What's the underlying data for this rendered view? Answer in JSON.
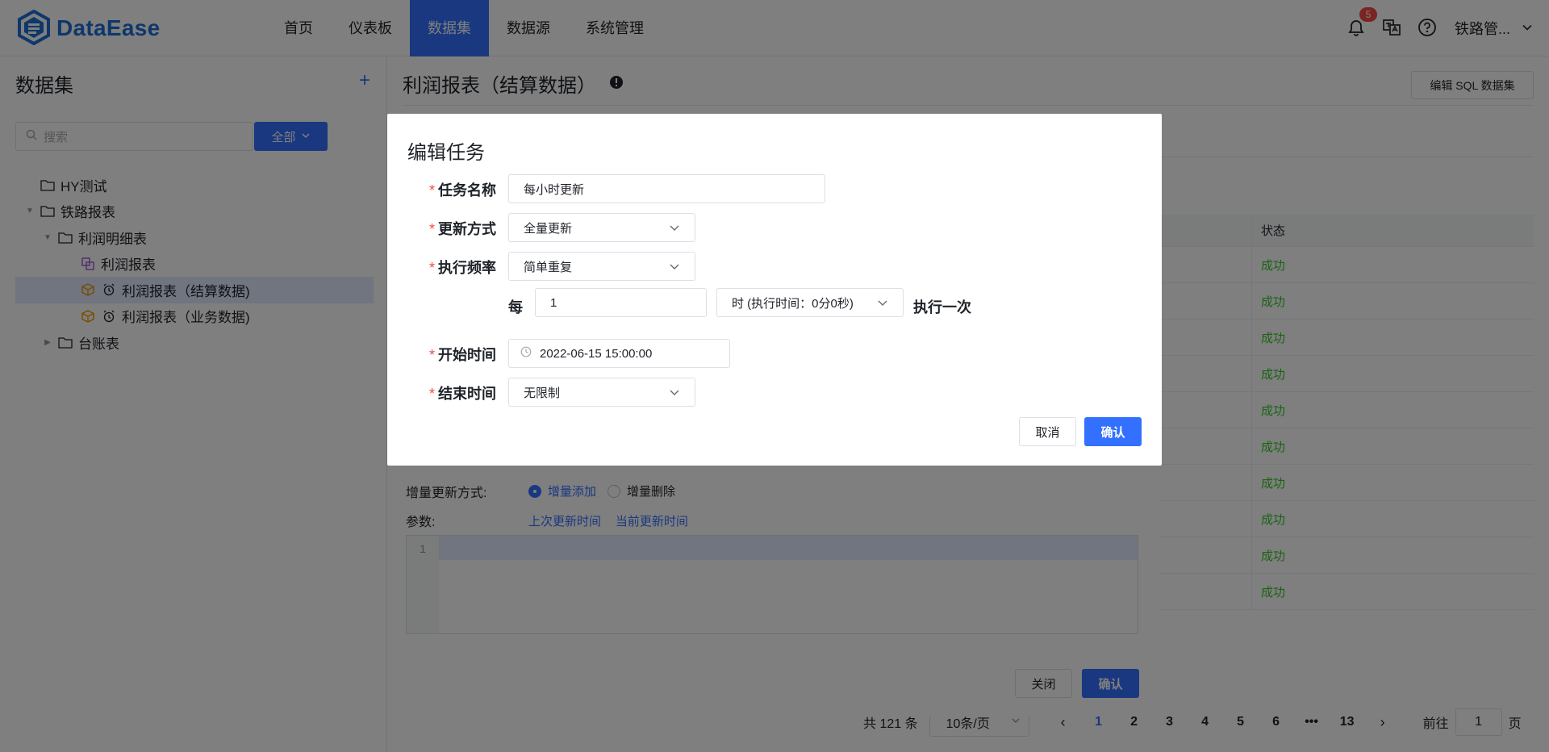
{
  "header": {
    "logo_text": "DataEase",
    "nav": [
      "首页",
      "仪表板",
      "数据集",
      "数据源",
      "系统管理"
    ],
    "active_nav_index": 2,
    "notification_count": "5",
    "user_name": "铁路管...",
    "accent": "#3370ff"
  },
  "sidebar": {
    "title": "数据集",
    "search_placeholder": "搜索",
    "filter_label": "全部",
    "tree": [
      {
        "label": "HY测试",
        "type": "folder",
        "depth": 0,
        "caret": ""
      },
      {
        "label": "铁路报表",
        "type": "folder",
        "depth": 0,
        "caret": "expanded"
      },
      {
        "label": "利润明细表",
        "type": "folder",
        "depth": 1,
        "caret": "expanded"
      },
      {
        "label": "利润报表",
        "type": "union",
        "depth": 2,
        "caret": ""
      },
      {
        "label": "利润报表（结算数据)",
        "type": "sql-scheduled",
        "depth": 2,
        "caret": "",
        "selected": true
      },
      {
        "label": "利润报表（业务数据)",
        "type": "sql-scheduled",
        "depth": 2,
        "caret": ""
      },
      {
        "label": "台账表",
        "type": "folder",
        "depth": 1,
        "caret": "collapsed"
      }
    ]
  },
  "main": {
    "title": "利润报表（结算数据）",
    "edit_sql_button": "编辑 SQL 数据集",
    "table_header_status": "状态",
    "rows_status": [
      "成功",
      "成功",
      "成功",
      "成功",
      "成功",
      "成功",
      "成功",
      "成功",
      "成功",
      "成功"
    ],
    "pagination": {
      "total": "共 121 条",
      "page_size": "10条/页",
      "pages": [
        "1",
        "2",
        "3",
        "4",
        "5",
        "6",
        "•••",
        "13"
      ],
      "current": "1",
      "goto_label": "前往",
      "goto_value": "1",
      "goto_suffix": "页"
    }
  },
  "task_dialog_behind": {
    "incremental_label": "增量更新方式:",
    "option_add": "增量添加",
    "option_delete": "增量删除",
    "params_label": "参数:",
    "param_last": "上次更新时间",
    "param_current": "当前更新时间",
    "editor_line": "1",
    "close_button": "关闭",
    "confirm_button": "确认"
  },
  "edit_task": {
    "title": "编辑任务",
    "name_label": "任务名称",
    "name_value": "每小时更新",
    "update_mode_label": "更新方式",
    "update_mode_value": "全量更新",
    "frequency_label": "执行频率",
    "frequency_value": "简单重复",
    "every_label": "每",
    "every_value": "1",
    "unit_value": "时 (执行时间：0分0秒)",
    "run_once_label": "执行一次",
    "start_label": "开始时间",
    "start_value": "2022-06-15 15:00:00",
    "end_label": "结束时间",
    "end_value": "无限制",
    "cancel_button": "取消",
    "confirm_button": "确认"
  }
}
